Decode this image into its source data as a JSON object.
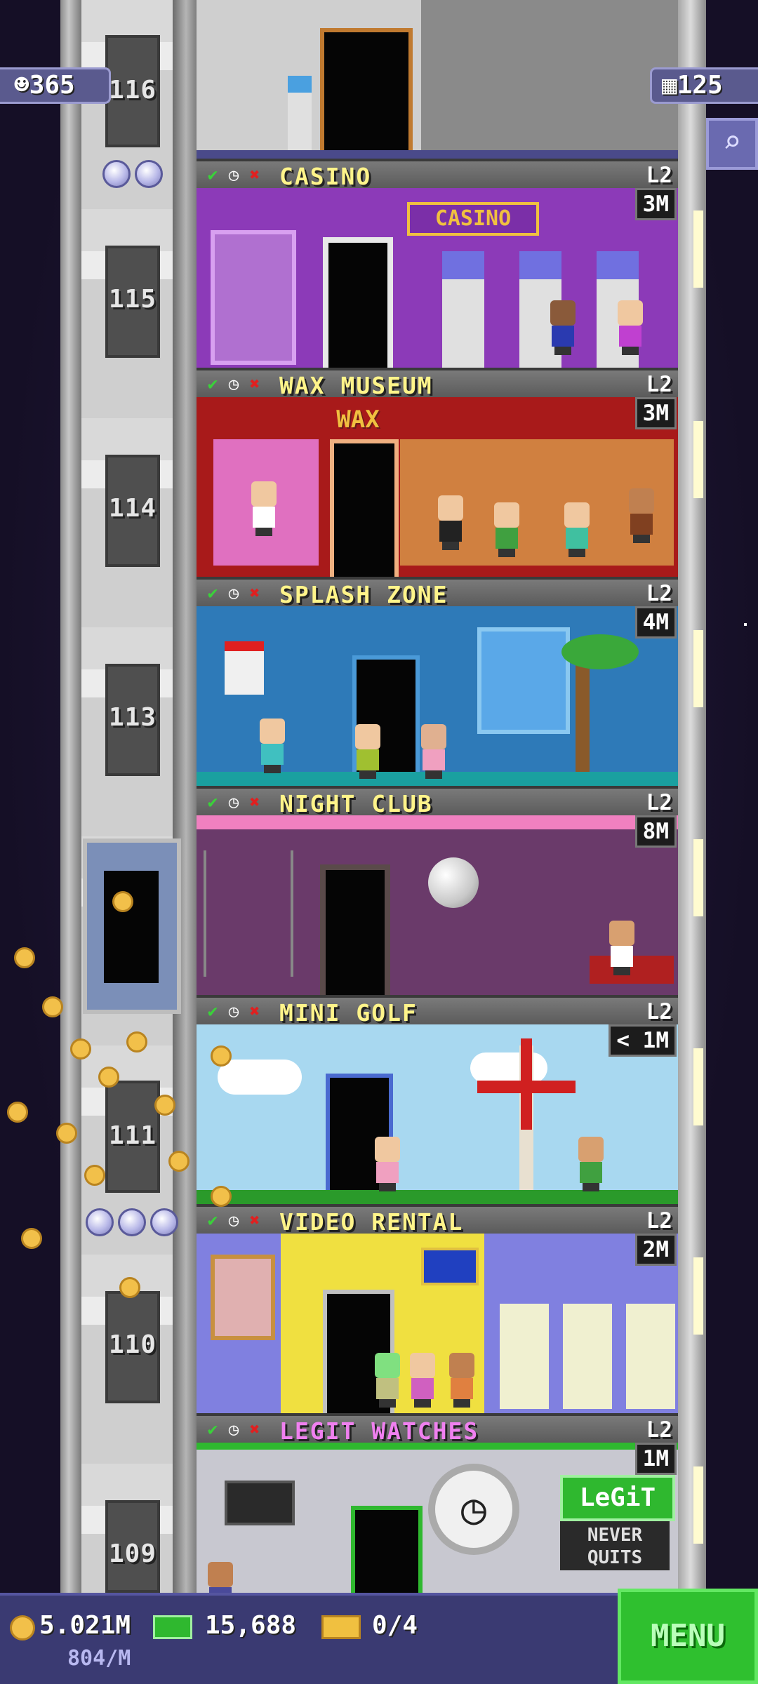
{
  "top_left_badge": {
    "icon": "population-icon",
    "value": "365"
  },
  "top_right_badge": {
    "icon": "floors-icon",
    "value": "125"
  },
  "search_icon": "search-icon",
  "shaft_numbers": [
    "116",
    "115",
    "114",
    "113",
    "111",
    "110",
    "109"
  ],
  "floors": [
    {
      "name": "CASINO",
      "level": "L2",
      "income": "3M",
      "sign": "CASINO",
      "sign_color": "#7b2fa8"
    },
    {
      "name": "WAX MUSEUM",
      "level": "L2",
      "income": "3M",
      "sign": "WAX",
      "sign_color": "#d8b24a"
    },
    {
      "name": "SPLASH ZONE",
      "level": "L2",
      "income": "4M",
      "sign": "",
      "sign_color": "#2a6aa0"
    },
    {
      "name": "NIGHT CLUB",
      "level": "L2",
      "income": "8M",
      "sign": "",
      "sign_color": "#6a3a6a"
    },
    {
      "name": "MINI GOLF",
      "level": "L2",
      "income": "< 1M",
      "sign": "",
      "sign_color": "#a8d8f0"
    },
    {
      "name": "VIDEO RENTAL",
      "level": "L2",
      "income": "2M",
      "sign": "",
      "sign_color": "#f0e040"
    },
    {
      "name": "LEGIT WATCHES",
      "level": "L2",
      "income": "1M",
      "sign": "LeGiT",
      "sign2": "NEVER QUITS",
      "sign_color": "#2fb82f"
    }
  ],
  "bottom": {
    "coins": "5.021M",
    "coins_rate": "804/M",
    "bux": "15,688",
    "tickets": "0/4",
    "menu_label": "MENU"
  },
  "colors": {
    "accent": "#5a5a8e",
    "menu": "#2fc02f",
    "floor_name": "#fff48a"
  }
}
